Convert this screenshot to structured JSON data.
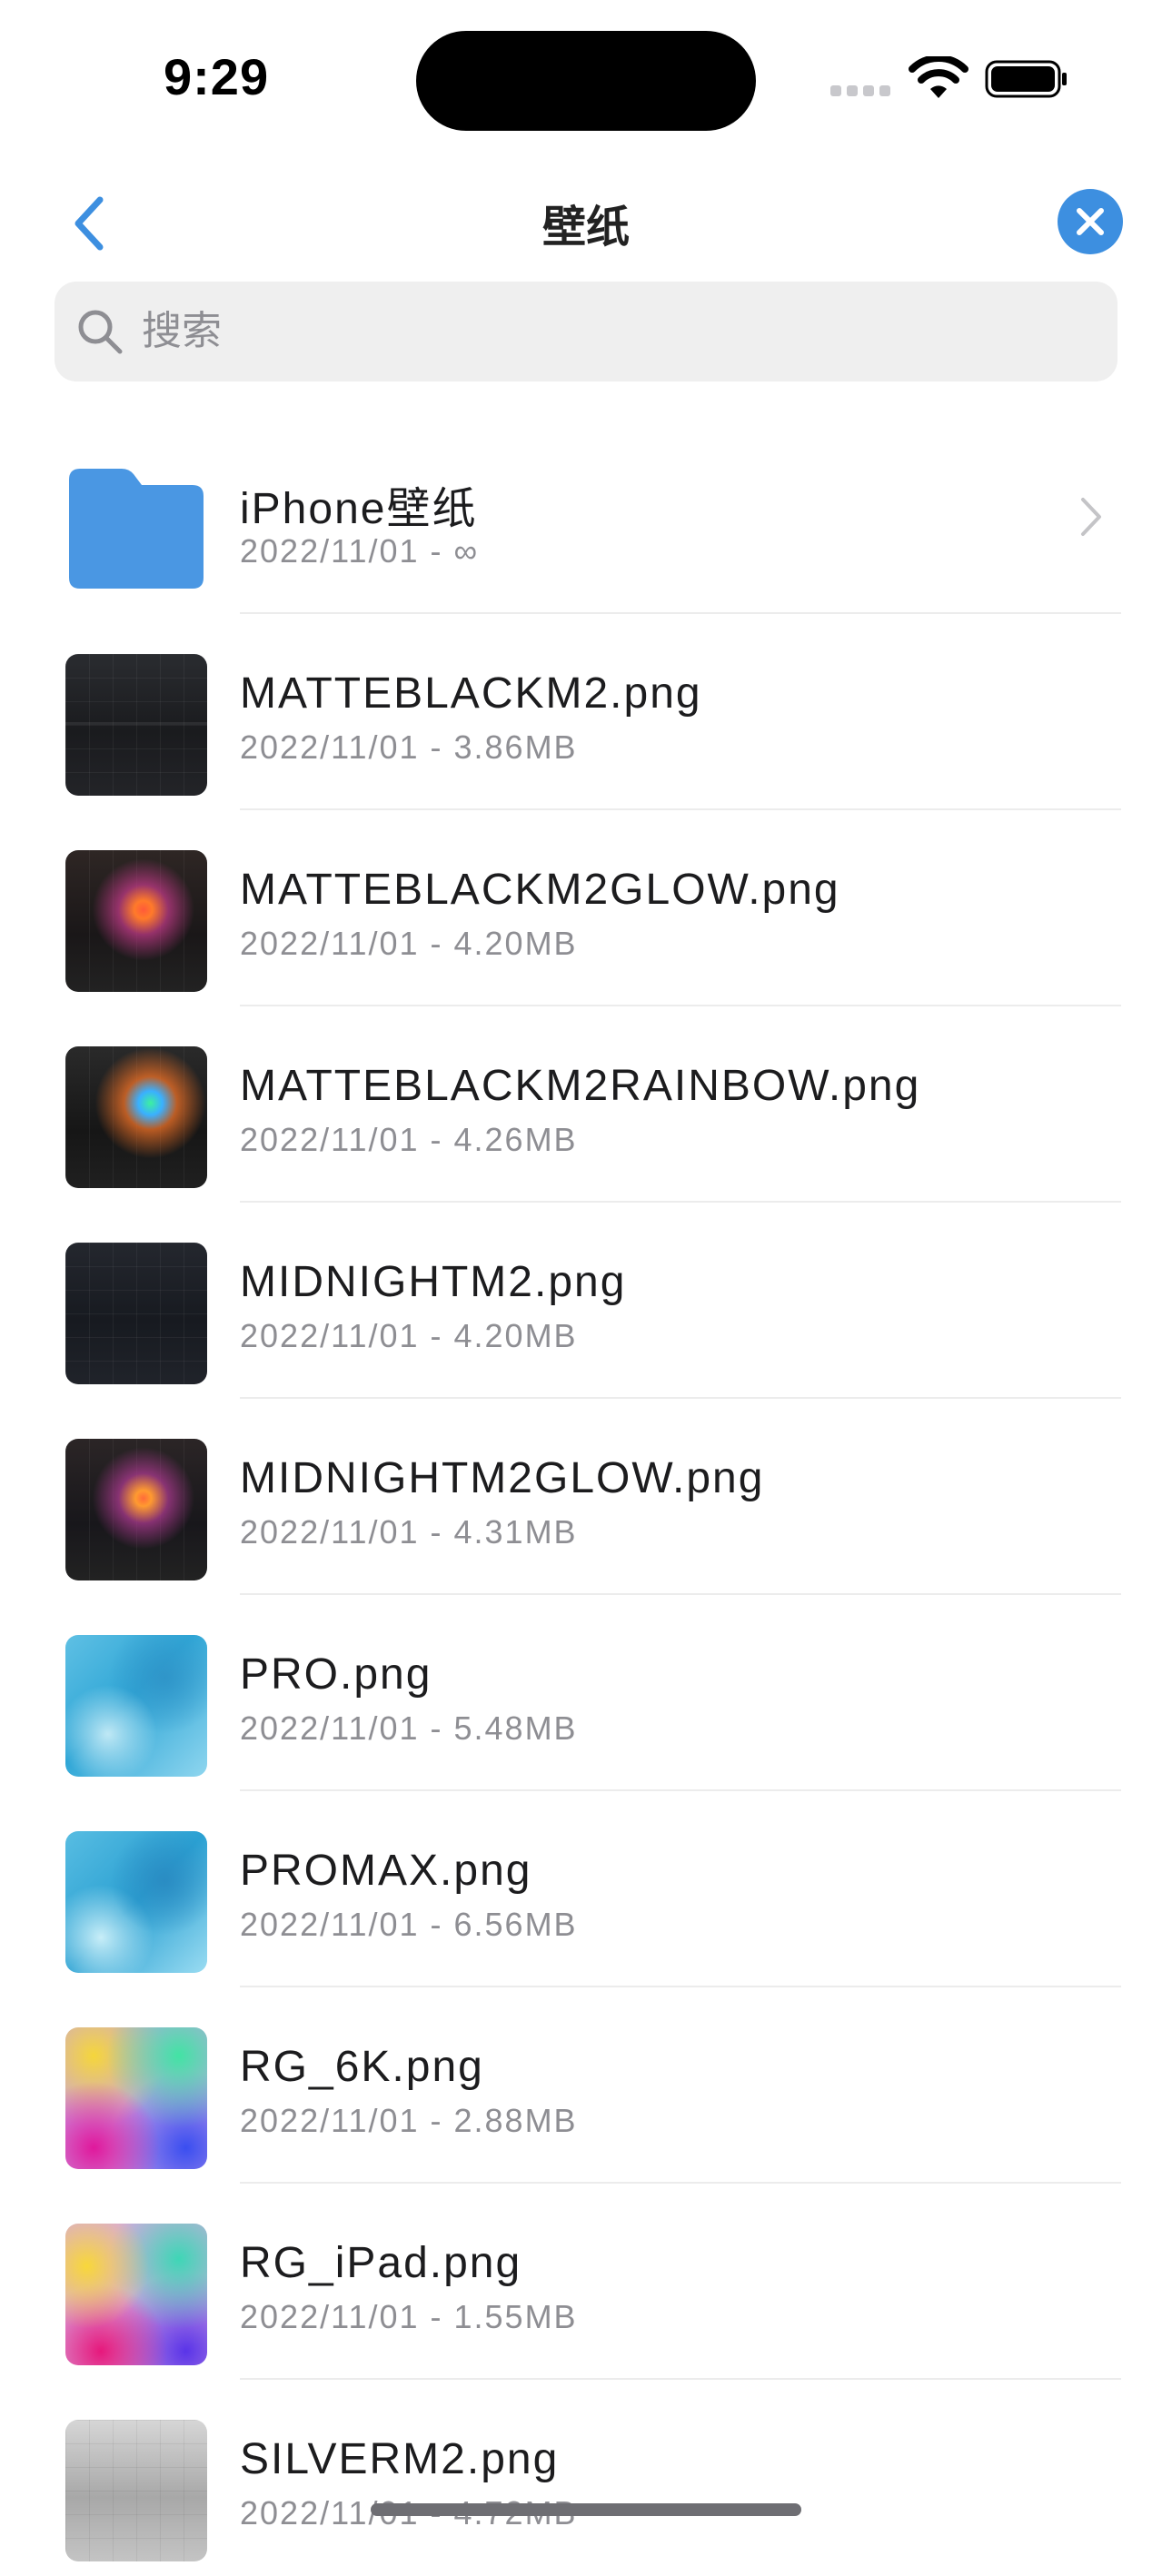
{
  "status_bar": {
    "time": "9:29"
  },
  "nav": {
    "title": "壁纸"
  },
  "search": {
    "placeholder": "搜索"
  },
  "items": [
    {
      "name": "iPhone壁纸",
      "meta": "2022/11/01 - ∞",
      "type": "folder"
    },
    {
      "name": "MATTEBLACKM2.png",
      "meta": "2022/11/01 - 3.86MB",
      "thumb": "t-dark"
    },
    {
      "name": "MATTEBLACKM2GLOW.png",
      "meta": "2022/11/01 - 4.20MB",
      "thumb": "t-glow"
    },
    {
      "name": "MATTEBLACKM2RAINBOW.png",
      "meta": "2022/11/01 - 4.26MB",
      "thumb": "t-rainbow"
    },
    {
      "name": "MIDNIGHTM2.png",
      "meta": "2022/11/01 - 4.20MB",
      "thumb": "t-midnight"
    },
    {
      "name": "MIDNIGHTM2GLOW.png",
      "meta": "2022/11/01 - 4.31MB",
      "thumb": "t-midglow"
    },
    {
      "name": "PRO.png",
      "meta": "2022/11/01 - 5.48MB",
      "thumb": "t-pro"
    },
    {
      "name": "PROMAX.png",
      "meta": "2022/11/01 - 6.56MB",
      "thumb": "t-promax"
    },
    {
      "name": "RG_6K.png",
      "meta": "2022/11/01 - 2.88MB",
      "thumb": "t-rg6k"
    },
    {
      "name": "RG_iPad.png",
      "meta": "2022/11/01 - 1.55MB",
      "thumb": "t-rgipad"
    },
    {
      "name": "SILVERM2.png",
      "meta": "2022/11/01 - 4.72MB",
      "thumb": "t-silver"
    }
  ],
  "colors": {
    "accent": "#3d8fe0",
    "folder": "#4a97e3",
    "secondary_text": "#8e8e93"
  },
  "icons": {
    "back": "chevron-left-icon",
    "close": "close-icon",
    "search": "search-icon",
    "folder": "folder-icon",
    "row_chevron": "chevron-right-icon"
  }
}
